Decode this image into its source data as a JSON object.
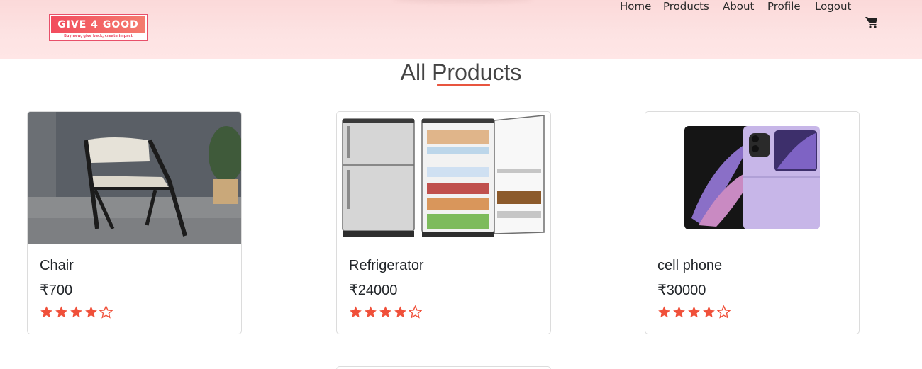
{
  "brand": {
    "name": "GIVE 4 GOOD",
    "tagline": "Buy new, give back, create impact"
  },
  "nav": [
    {
      "label": "Home"
    },
    {
      "label": "Products"
    },
    {
      "label": "About"
    },
    {
      "label": "Profile"
    },
    {
      "label": "Logout"
    }
  ],
  "page": {
    "title": "All Products"
  },
  "products": [
    {
      "name": "Chair",
      "price": "₹700",
      "rating": 4,
      "max_rating": 5
    },
    {
      "name": "Refrigerator",
      "price": "₹24000",
      "rating": 4,
      "max_rating": 5
    },
    {
      "name": "cell phone",
      "price": "₹30000",
      "rating": 4,
      "max_rating": 5
    }
  ],
  "colors": {
    "accent": "#e8553f",
    "star": "#f0503a",
    "navbar": "#fde3e3"
  },
  "icons": {
    "cart": "shopping-cart-icon",
    "star_filled": "star-filled-icon",
    "star_empty": "star-outline-icon"
  }
}
